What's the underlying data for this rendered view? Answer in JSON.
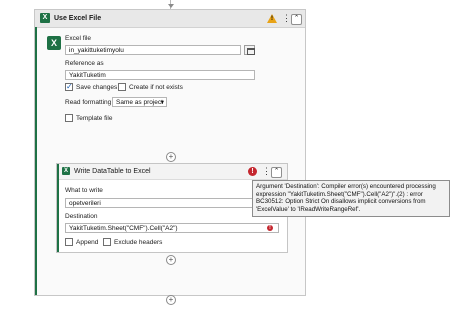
{
  "outer_activity": {
    "title": "Use Excel File",
    "icon": "excel-icon",
    "excel_file_label": "Excel file",
    "excel_file_value": "in_yakittuketimyolu",
    "reference_as_label": "Reference as",
    "reference_as_value": "YakitTuketim",
    "save_changes_label": "Save changes",
    "save_changes_checked": true,
    "create_if_not_exists_label": "Create if not exists",
    "create_if_not_exists_checked": false,
    "read_formatting_label": "Read formatting",
    "read_formatting_value": "Same as project",
    "template_file_label": "Template file",
    "template_file_checked": false
  },
  "inner_activity": {
    "title": "Write DataTable to Excel",
    "what_to_write_label": "What to write",
    "what_to_write_value": "opetverileri",
    "destination_label": "Destination",
    "destination_value": "YakitTuketim.Sheet(\"CMF\").Cell(\"A2\")",
    "append_label": "Append",
    "append_checked": false,
    "exclude_headers_label": "Exclude headers",
    "exclude_headers_checked": false
  },
  "tooltip": {
    "text": "Argument 'Destination': Compiler error(s) encountered processing expression \"YakitTuketim.Sheet(\"CMF\").Cell(\"A2\")\".(2) : error BC30512: Option Strict On disallows implicit conversions from 'ExcelValue' to 'IReadWriteRangeRef'."
  },
  "symbols": {
    "collapse": "⌃",
    "kebab": "⋮",
    "error": "!",
    "warning": "!",
    "add": "+",
    "dropdown": "▾",
    "excel_letter": "X"
  },
  "colors": {
    "excel_green": "#1e7145",
    "error_red": "#c4262e",
    "warning_orange": "#e8a317"
  }
}
